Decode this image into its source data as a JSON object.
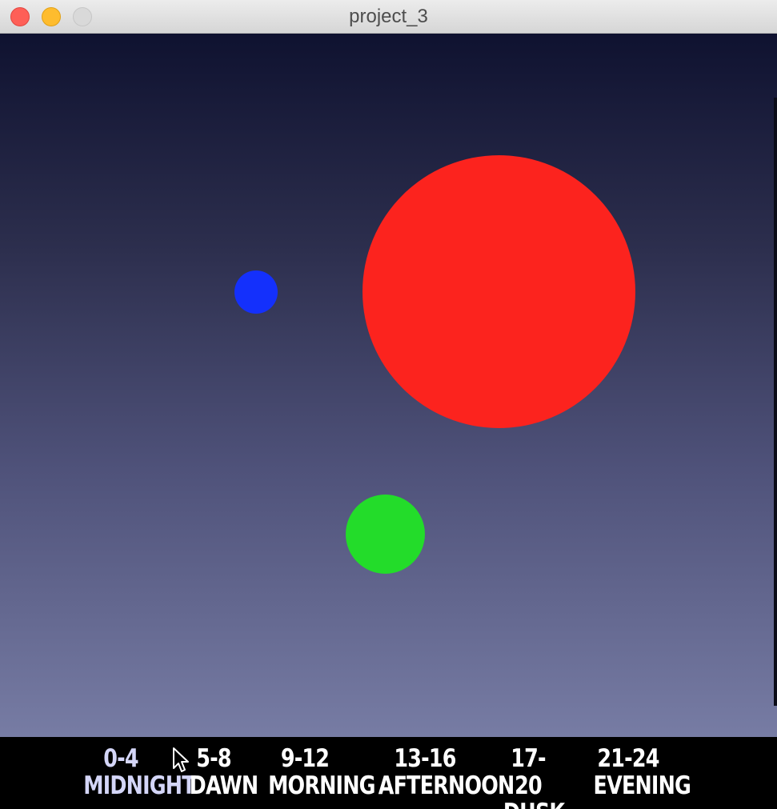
{
  "window": {
    "title": "project_3"
  },
  "canvas": {
    "background_top": "#0f1230",
    "background_bottom": "#777ca4",
    "circles": [
      {
        "name": "red",
        "color": "#fc231e"
      },
      {
        "name": "blue",
        "color": "#1430fc"
      },
      {
        "name": "green",
        "color": "#23dc2a"
      }
    ]
  },
  "legend": {
    "segments": [
      {
        "range": "0-4",
        "label": "MIDNIGHT",
        "active": true
      },
      {
        "range": "5-8",
        "label": "DAWN",
        "active": false
      },
      {
        "range": "9-12",
        "label": "MORNING",
        "active": false
      },
      {
        "range": "13-16",
        "label": "AFTERNOON",
        "active": false
      },
      {
        "range": "17-20",
        "label": "DUSK",
        "active": false
      },
      {
        "range": "21-24",
        "label": "EVENING",
        "active": false
      }
    ]
  },
  "cursor": {
    "icon": "arrow-cursor-icon"
  }
}
